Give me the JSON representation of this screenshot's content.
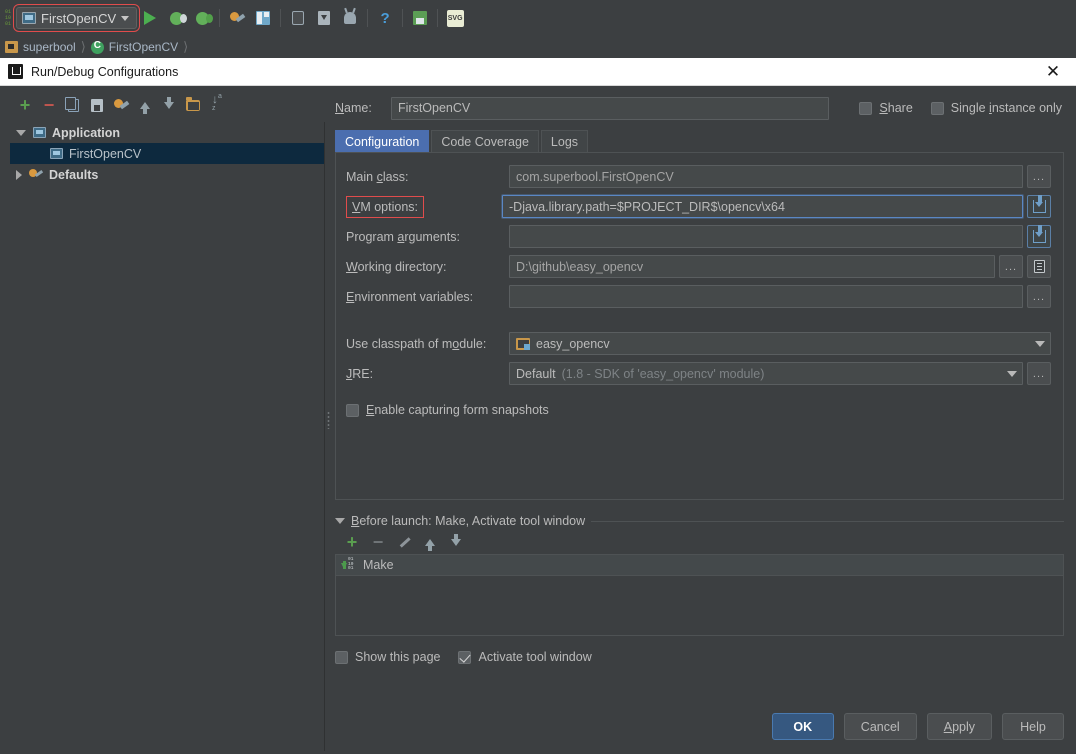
{
  "ide": {
    "run_config_selector": {
      "label": "FirstOpenCV",
      "highlighted": true,
      "icon": "application-config-icon"
    },
    "toolbar_icons": [
      {
        "name": "run-icon",
        "title": "Run"
      },
      {
        "name": "debug-icon",
        "title": "Debug"
      },
      {
        "name": "run-coverage-icon",
        "title": "Run with Coverage"
      },
      {
        "name": "project-structure-icon",
        "title": "Project Structure"
      },
      {
        "name": "sdk-manager-icon",
        "title": "SDK Manager"
      },
      {
        "name": "avd-manager-icon",
        "title": "AVD Manager"
      },
      {
        "name": "sync-gradle-icon",
        "title": "Sync Project"
      },
      {
        "name": "android-device-icon",
        "title": "Android Device Monitor"
      },
      {
        "name": "help-icon",
        "title": "Help"
      },
      {
        "name": "save-all-icon",
        "title": "Save All"
      },
      {
        "name": "svg-icon",
        "title": "SVG"
      }
    ],
    "breadcrumb": [
      {
        "label": "superbool",
        "icon": "project-folder-icon"
      },
      {
        "label": "FirstOpenCV",
        "icon": "java-class-icon"
      }
    ]
  },
  "dialog": {
    "title": "Run/Debug Configurations",
    "close_label": "✕",
    "tree_toolbar": [
      {
        "name": "add-configuration-button",
        "glyph": "+"
      },
      {
        "name": "remove-configuration-button",
        "glyph": "−"
      },
      {
        "name": "copy-configuration-button",
        "glyph": "copy-icon"
      },
      {
        "name": "save-configuration-button",
        "glyph": "save-icon"
      },
      {
        "name": "edit-defaults-button",
        "glyph": "wrench-icon"
      },
      {
        "name": "move-up-button",
        "glyph": "arrow-up-icon"
      },
      {
        "name": "move-down-button",
        "glyph": "arrow-down-icon"
      },
      {
        "name": "create-folder-button",
        "glyph": "folder-icon"
      },
      {
        "name": "sort-configurations-button",
        "glyph": "sort-az-icon"
      }
    ],
    "tree": [
      {
        "label": "Application",
        "level": 0,
        "expanded": true,
        "bold": true,
        "selected": false,
        "icon": "application-icon"
      },
      {
        "label": "FirstOpenCV",
        "level": 1,
        "expanded": null,
        "bold": false,
        "selected": true,
        "icon": "application-config-icon"
      },
      {
        "label": "Defaults",
        "level": 0,
        "expanded": false,
        "bold": true,
        "selected": false,
        "icon": "defaults-icon"
      }
    ],
    "name": {
      "label": "Name:",
      "value": "FirstOpenCV",
      "placeholder": ""
    },
    "share": {
      "label": "Share",
      "checked": false
    },
    "single_instance": {
      "label": "Single instance only",
      "checked": false
    },
    "tabs": [
      {
        "label": "Configuration",
        "active": true
      },
      {
        "label": "Code Coverage",
        "active": false
      },
      {
        "label": "Logs",
        "active": false
      }
    ],
    "fields": {
      "main_class": {
        "label": "Main class:",
        "value": "com.superbool.FirstOpenCV",
        "browse_label": "..."
      },
      "vm_options": {
        "label": "VM options:",
        "value": "-Djava.library.path=$PROJECT_DIR$\\opencv\\x64",
        "highlighted": true,
        "focused": true,
        "expand_label": "expand-icon"
      },
      "program_arguments": {
        "label": "Program arguments:",
        "value": "",
        "expand_label": "expand-icon"
      },
      "working_directory": {
        "label": "Working directory:",
        "value": "D:\\github\\easy_opencv",
        "browse_label": "...",
        "macros_label": "macros-icon"
      },
      "environment_variables": {
        "label": "Environment variables:",
        "value": "",
        "browse_label": "..."
      },
      "use_classpath_of_module": {
        "label": "Use classpath of module:",
        "value": "easy_opencv",
        "icon": "module-icon"
      },
      "jre": {
        "label": "JRE:",
        "value": "Default",
        "hint": "(1.8 - SDK of 'easy_opencv' module)",
        "browse_label": "..."
      },
      "enable_capturing_form_snapshots": {
        "label": "Enable capturing form snapshots",
        "checked": false
      }
    },
    "before_launch": {
      "title": "Before launch: Make, Activate tool window",
      "expanded": true,
      "toolbar": [
        {
          "name": "add-task-button",
          "glyph": "+"
        },
        {
          "name": "remove-task-button",
          "glyph": "−"
        },
        {
          "name": "edit-task-button",
          "glyph": "pencil-icon"
        },
        {
          "name": "move-task-up-button",
          "glyph": "arrow-up-icon"
        },
        {
          "name": "move-task-down-button",
          "glyph": "arrow-down-icon"
        }
      ],
      "items": [
        {
          "label": "Make",
          "icon": "make-icon"
        }
      ],
      "show_this_page": {
        "label": "Show this page",
        "checked": false
      },
      "activate_tool_window": {
        "label": "Activate tool window",
        "checked": true
      }
    },
    "buttons": [
      {
        "label": "OK",
        "name": "ok-button",
        "primary": true
      },
      {
        "label": "Cancel",
        "name": "cancel-button",
        "primary": false
      },
      {
        "label": "Apply",
        "name": "apply-button",
        "primary": false
      },
      {
        "label": "Help",
        "name": "help-button",
        "primary": false
      }
    ]
  },
  "colors": {
    "background": "#3c3f41",
    "field_background": "#45494a",
    "accent_tab": "#4b6eaf",
    "selection": "#0d293e",
    "highlight_box": "#e04c4c",
    "primary_button": "#365880",
    "text": "#bbbbbb"
  }
}
